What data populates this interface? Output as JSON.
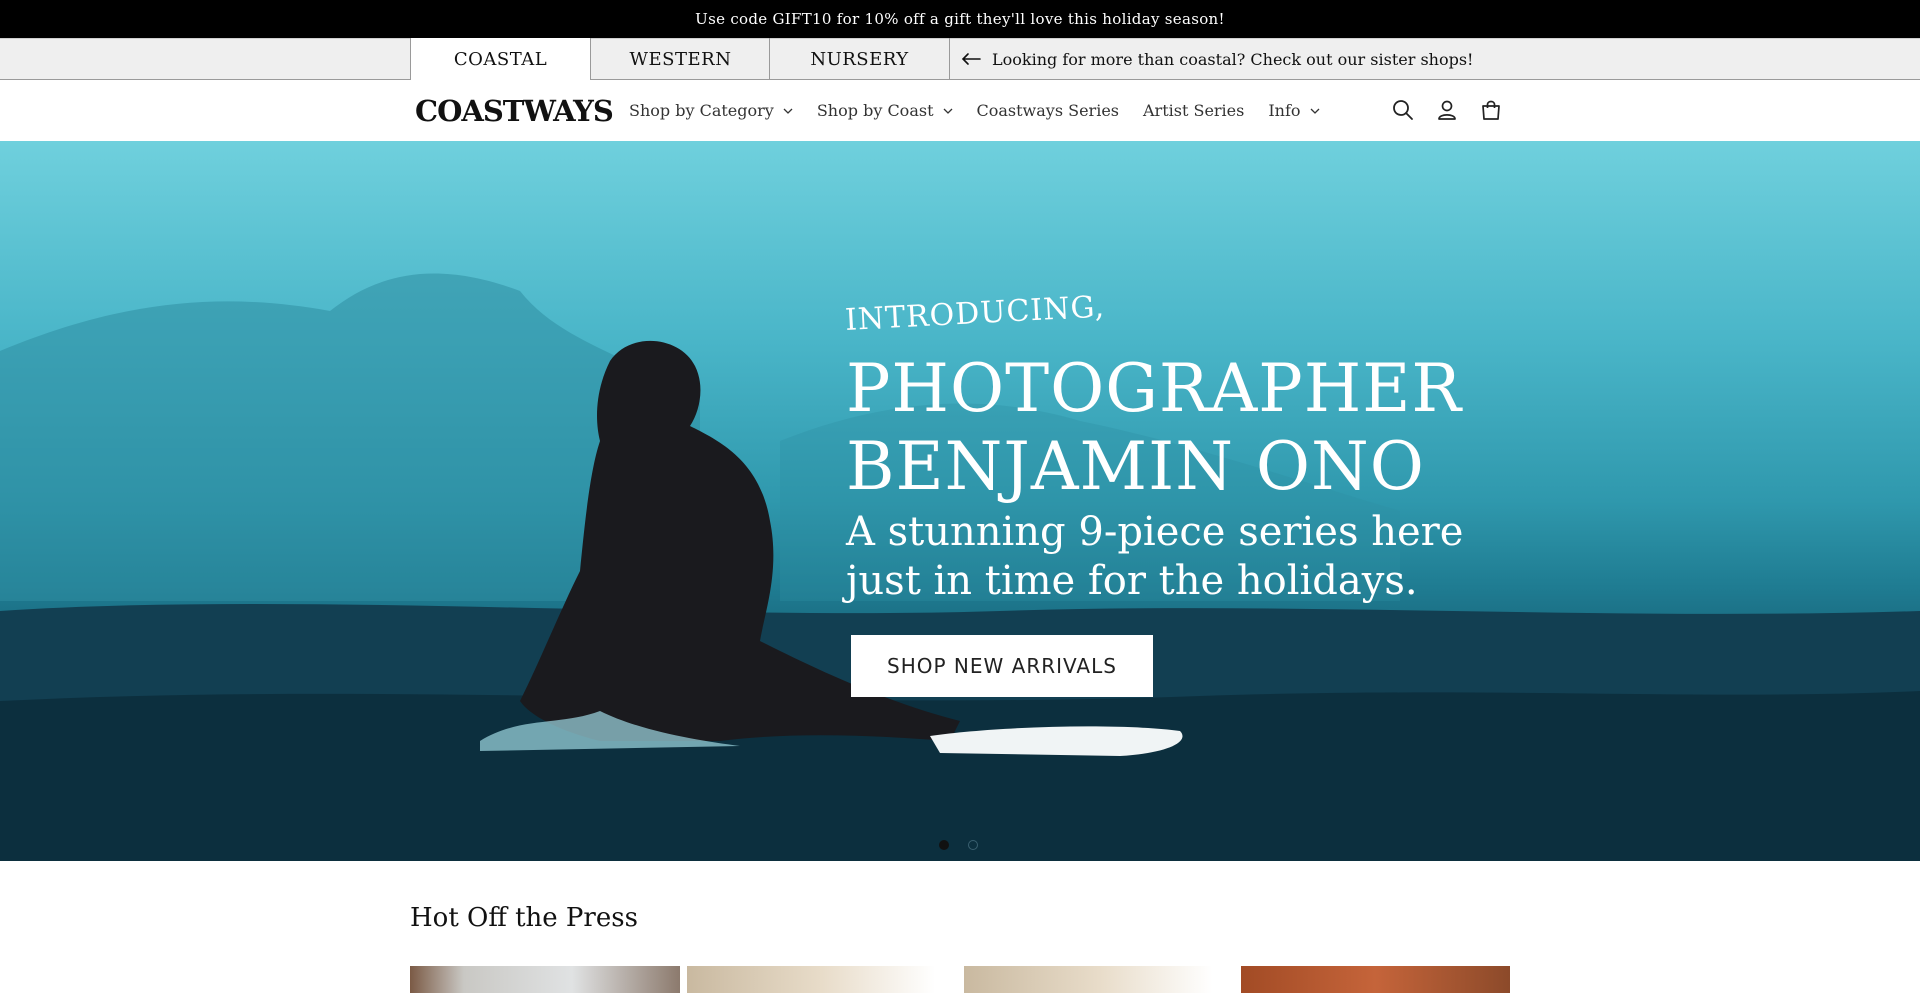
{
  "announcement": {
    "text": "Use code GIFT10 for 10% off a gift they'll love this holiday season!"
  },
  "shop_switcher": {
    "tabs": [
      {
        "label": "COASTAL",
        "active": true
      },
      {
        "label": "WESTERN",
        "active": false
      },
      {
        "label": "NURSERY",
        "active": false
      }
    ],
    "sister_text": "Looking for more than coastal? Check out our sister shops!",
    "arrow_icon": "arrow-left-icon"
  },
  "header": {
    "logo": "COASTWAYS",
    "nav": [
      {
        "label": "Shop by Category",
        "dropdown": true
      },
      {
        "label": "Shop by Coast",
        "dropdown": true
      },
      {
        "label": "Coastways Series",
        "dropdown": false
      },
      {
        "label": "Artist Series",
        "dropdown": false
      },
      {
        "label": "Info",
        "dropdown": true
      }
    ],
    "icons": [
      "search-icon",
      "account-icon",
      "cart-icon"
    ]
  },
  "hero": {
    "intro": "INTRODUCING,",
    "headline_line1": "PHOTOGRAPHER",
    "headline_line2": "BENJAMIN ONO",
    "subline_line1": "A stunning 9-piece series here",
    "subline_line2": "just in time for the holidays.",
    "cta_label": "SHOP NEW ARRIVALS",
    "slides": {
      "total": 2,
      "current": 1
    }
  },
  "section": {
    "title": "Hot Off the Press",
    "cards": 4
  },
  "colors": {
    "announcement_bg": "#000000",
    "switcher_bg": "#efefef",
    "hero_teal": "#49b5c8",
    "text": "#1a1a1a"
  }
}
